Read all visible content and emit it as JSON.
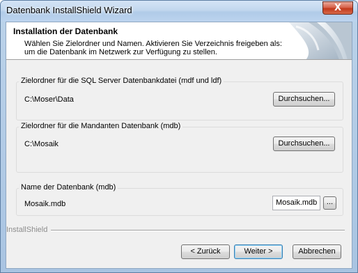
{
  "window": {
    "title": "Datenbank InstallShield Wizard",
    "close_symbol": "X"
  },
  "header": {
    "title": "Installation der Datenbank",
    "description": "Wählen Sie Zielordner und Namen. Aktivieren Sie Verzeichnis freigeben als: um die Datenbank im Netzwerk zur Verfügung zu stellen."
  },
  "groups": {
    "sql_folder": {
      "label": "Zielordner für die SQL Server Datenbankdatei (mdf und ldf)",
      "path": "C:\\Moser\\Data",
      "browse_label": "Durchsuchen..."
    },
    "mandanten_folder": {
      "label": "Zielordner für die Mandanten Datenbank (mdb)",
      "path": "C:\\Mosaik",
      "browse_label": "Durchsuchen..."
    },
    "db_name": {
      "label": "Name der Datenbank (mdb)",
      "file": "Mosaik.mdb",
      "input_value": "Mosaik.mdb",
      "ellipsis_label": "..."
    }
  },
  "brand": "InstallShield",
  "buttons": {
    "back": "< Zurück",
    "next": "Weiter >",
    "cancel": "Abbrechen"
  },
  "colors": {
    "accent": "#3c7fb1",
    "close": "#c2391c"
  }
}
